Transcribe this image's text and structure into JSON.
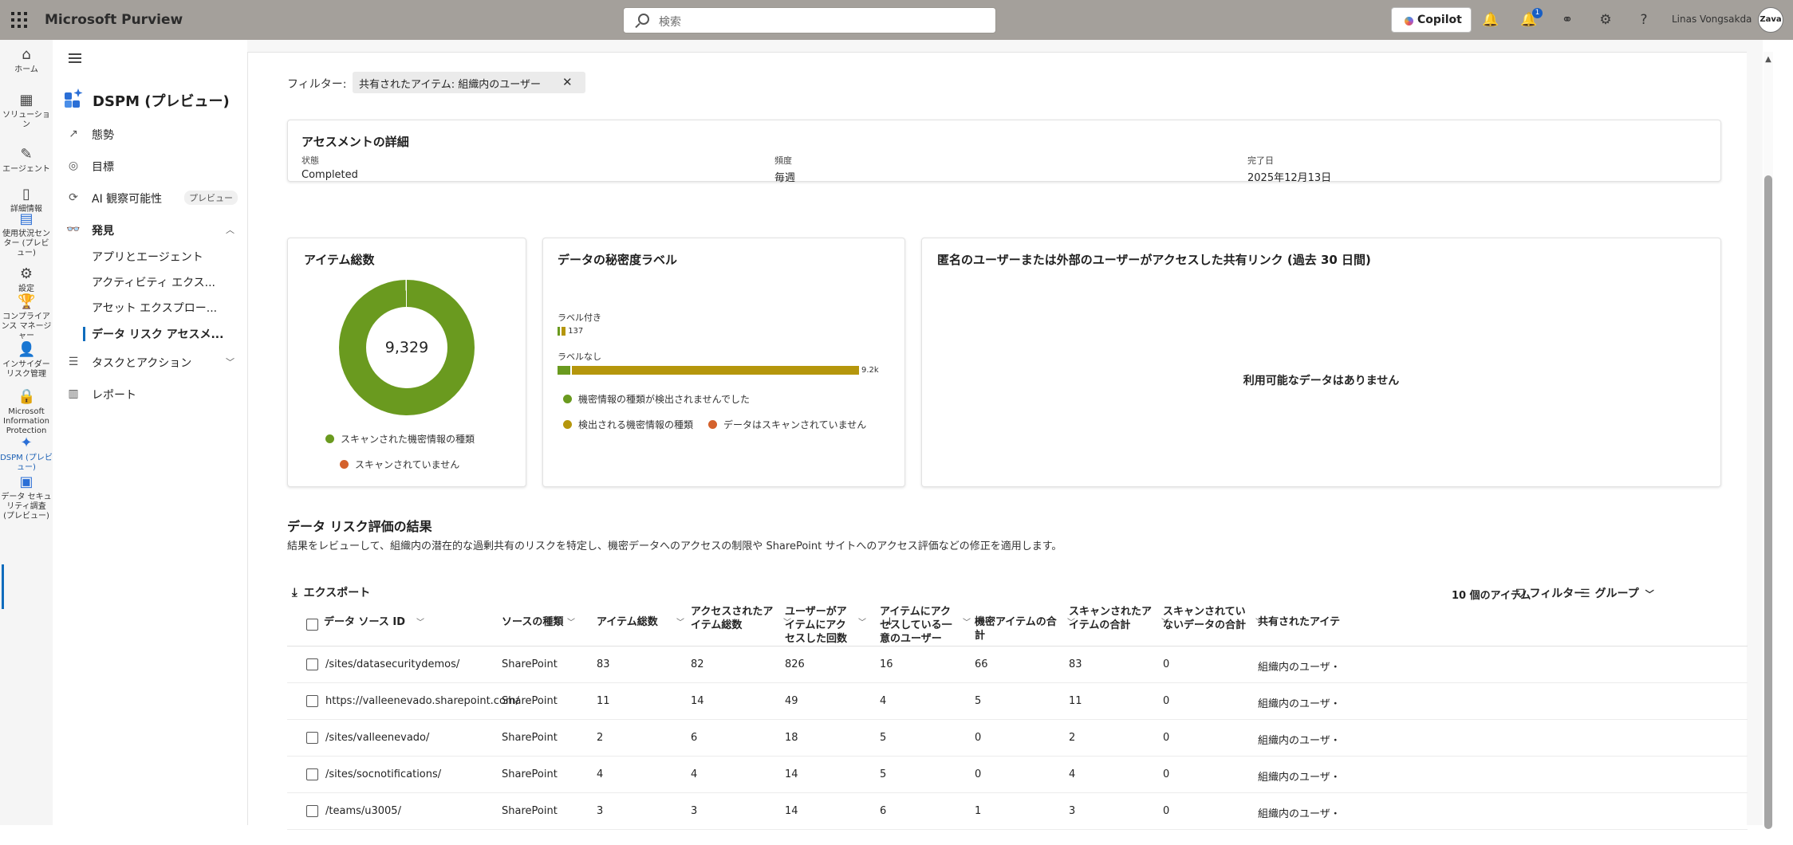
{
  "app": {
    "title": "Microsoft Purview"
  },
  "topbar": {
    "search_placeholder": "検索",
    "copilot_label": "Copilot",
    "notification_count": "1",
    "user_name": "Linas Vongsakda",
    "avatar_text": "Zava"
  },
  "rail": [
    {
      "icon": "home-icon",
      "glyph": "⌂",
      "label": "ホーム"
    },
    {
      "icon": "solutions-icon",
      "glyph": "▦",
      "label": "ソリューション"
    },
    {
      "icon": "agents-icon",
      "glyph": "✎",
      "label": "エージェント"
    },
    {
      "icon": "learn-icon",
      "glyph": "▯",
      "label": "詳細情報"
    },
    {
      "icon": "usage-icon",
      "glyph": "▤",
      "label": "使用状況センター (プレビュー)"
    },
    {
      "icon": "settings-icon",
      "glyph": "⚙",
      "label": "設定"
    },
    {
      "icon": "compliance-manager-icon",
      "glyph": "🏆",
      "label": "コンプライアンス マネージャー"
    },
    {
      "icon": "insider-risk-icon",
      "glyph": "👤",
      "label": "インサイダー リスク管理"
    },
    {
      "icon": "information-protection-icon",
      "glyph": "🔒",
      "label": "Microsoft Information Protection"
    },
    {
      "icon": "dspm-icon",
      "glyph": "✦",
      "label": "DSPM (プレビュー)"
    },
    {
      "icon": "data-security-investigations-icon",
      "glyph": "▣",
      "label": "データ セキュリティ調査 (プレビュー)"
    }
  ],
  "nav": {
    "title": "DSPM (プレビュー)",
    "items": [
      {
        "label": "態勢",
        "icon": "trend-icon",
        "glyph": "↗"
      },
      {
        "label": "目標",
        "icon": "target-icon",
        "glyph": "◎"
      },
      {
        "label": "AI 観察可能性",
        "icon": "ai-observe-icon",
        "glyph": "⟳",
        "badge": "プレビュー"
      },
      {
        "label": "発見",
        "icon": "discover-icon",
        "glyph": "👓"
      },
      {
        "label": "アプリとエージェント"
      },
      {
        "label": "アクティビティ エクス..."
      },
      {
        "label": "アセット エクスプロー..."
      },
      {
        "label": "データ リスク アセスメ..."
      },
      {
        "label": "タスクとアクション",
        "icon": "tasks-icon",
        "glyph": "☰"
      },
      {
        "label": "レポート",
        "icon": "report-icon",
        "glyph": "▥"
      }
    ]
  },
  "filter": {
    "label": "フィルター:",
    "chip": "共有されたアイテム: 組織内のユーザー"
  },
  "assessment": {
    "title": "アセスメントの詳細",
    "status_label": "状態",
    "status": "Completed",
    "freq_label": "頻度",
    "freq": "毎週",
    "done_label": "完了日",
    "done": "2025年12月13日"
  },
  "items_card": {
    "title": "アイテム総数",
    "total": "9,329",
    "legend_scanned": "スキャンされた機密情報の種類",
    "legend_unscanned": "スキャンされていません"
  },
  "labels_card": {
    "title": "データの秘密度ラベル",
    "labeled_title": "ラベル付き",
    "labeled_value": "137",
    "unlabeled_title": "ラベルなし",
    "unlabeled_value": "9.2k",
    "legend_not_detected": "機密情報の種類が検出されませんでした",
    "legend_detected": "検出される機密情報の種類",
    "legend_not_scanned": "データはスキャンされていません"
  },
  "share_card": {
    "title": "匿名のユーザーまたは外部のユーザーがアクセスした共有リンク (過去 30 日間)",
    "no_data": "利用可能なデータはありません"
  },
  "chart_data": [
    {
      "type": "pie",
      "title": "アイテム総数",
      "labels": [
        "スキャンされた機密情報の種類",
        "スキャンされていません"
      ],
      "values": [
        9329,
        0
      ],
      "center_text": "9,329"
    },
    {
      "type": "bar",
      "title": "データの秘密度ラベル",
      "categories": [
        "ラベル付き",
        "ラベルなし"
      ],
      "series": [
        {
          "name": "機密情報の種類が検出されませんでした",
          "values": [
            10,
            400
          ]
        },
        {
          "name": "検出される機密情報の種類",
          "values": [
            127,
            8800
          ]
        },
        {
          "name": "データはスキャンされていません",
          "values": [
            0,
            0
          ]
        }
      ],
      "data_labels": [
        "137",
        "9.2k"
      ]
    }
  ],
  "results": {
    "title": "データ リスク評価の結果",
    "description": "結果をレビューして、組織内の潜在的な過剰共有のリスクを特定し、機密データへのアクセスの制限や SharePoint サイトへのアクセス評価などの修正を適用します。"
  },
  "toolbar": {
    "export": "エクスポート",
    "count": "10 個のアイテム",
    "filter": "フィルター",
    "group": "グループ"
  },
  "table": {
    "columns": [
      "データ ソース ID",
      "ソースの種類",
      "アイテム総数",
      "アクセスされたアイテム総数",
      "ユーザーがアイテムにアクセスした回数",
      "アイテムにアクセスしている一意のユーザー",
      "機密アイテムの合計",
      "スキャンされたアイテムの合計",
      "スキャンされていないデータの合計",
      "共有されたアイテ"
    ],
    "rows": [
      [
        "/sites/datasecuritydemos/",
        "SharePoint",
        "83",
        "82",
        "826",
        "16",
        "66",
        "83",
        "0",
        "組織内のユーザ・"
      ],
      [
        "https://valleenevado.sharepoint.com/",
        "SharePoint",
        "11",
        "14",
        "49",
        "4",
        "5",
        "11",
        "0",
        "組織内のユーザ・"
      ],
      [
        "/sites/valleenevado/",
        "SharePoint",
        "2",
        "6",
        "18",
        "5",
        "0",
        "2",
        "0",
        "組織内のユーザ・"
      ],
      [
        "/sites/socnotifications/",
        "SharePoint",
        "4",
        "4",
        "14",
        "5",
        "0",
        "4",
        "0",
        "組織内のユーザ・"
      ],
      [
        "/teams/u3005/",
        "SharePoint",
        "3",
        "3",
        "14",
        "6",
        "1",
        "3",
        "0",
        "組織内のユーザ・"
      ]
    ]
  },
  "colors": {
    "green": "#6a9a1f",
    "gold": "#b5960c",
    "orange": "#d4612c",
    "accent": "#0f6cbd"
  }
}
